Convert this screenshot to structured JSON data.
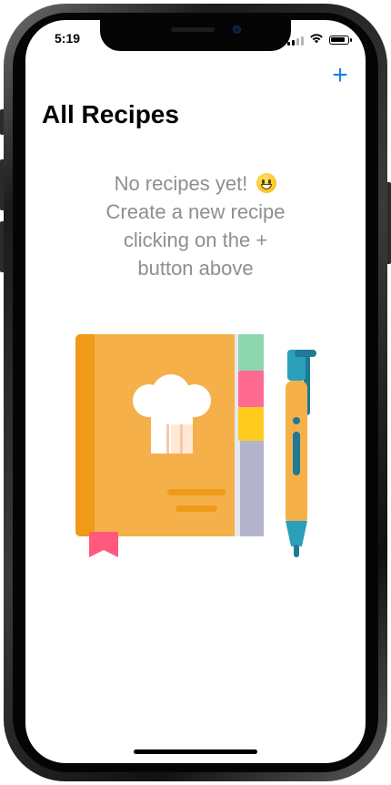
{
  "status_bar": {
    "time": "5:19",
    "icons": [
      "cellular-signal-icon",
      "wifi-icon",
      "battery-icon"
    ]
  },
  "nav": {
    "add_button_label": "+",
    "title": "All Recipes"
  },
  "empty_state": {
    "line1": "No recipes yet!",
    "emoji": "grinning-face-icon",
    "line2": "Create a new recipe",
    "line3": "clicking on the +",
    "line4": "button above",
    "illustration": "recipe-book-and-pen-illustration"
  },
  "colors": {
    "accent": "#1a7cf5",
    "placeholder_text": "#8e8e93",
    "title_text": "#000000",
    "book_cover": "#f5b04a",
    "book_spine": "#ef9b17",
    "bookmark": "#ff5a7e",
    "tab_green": "#8cd7ad",
    "tab_pink": "#ff6a93",
    "tab_yellow": "#ffcc1f",
    "pen_teal": "#2aa0ba"
  }
}
